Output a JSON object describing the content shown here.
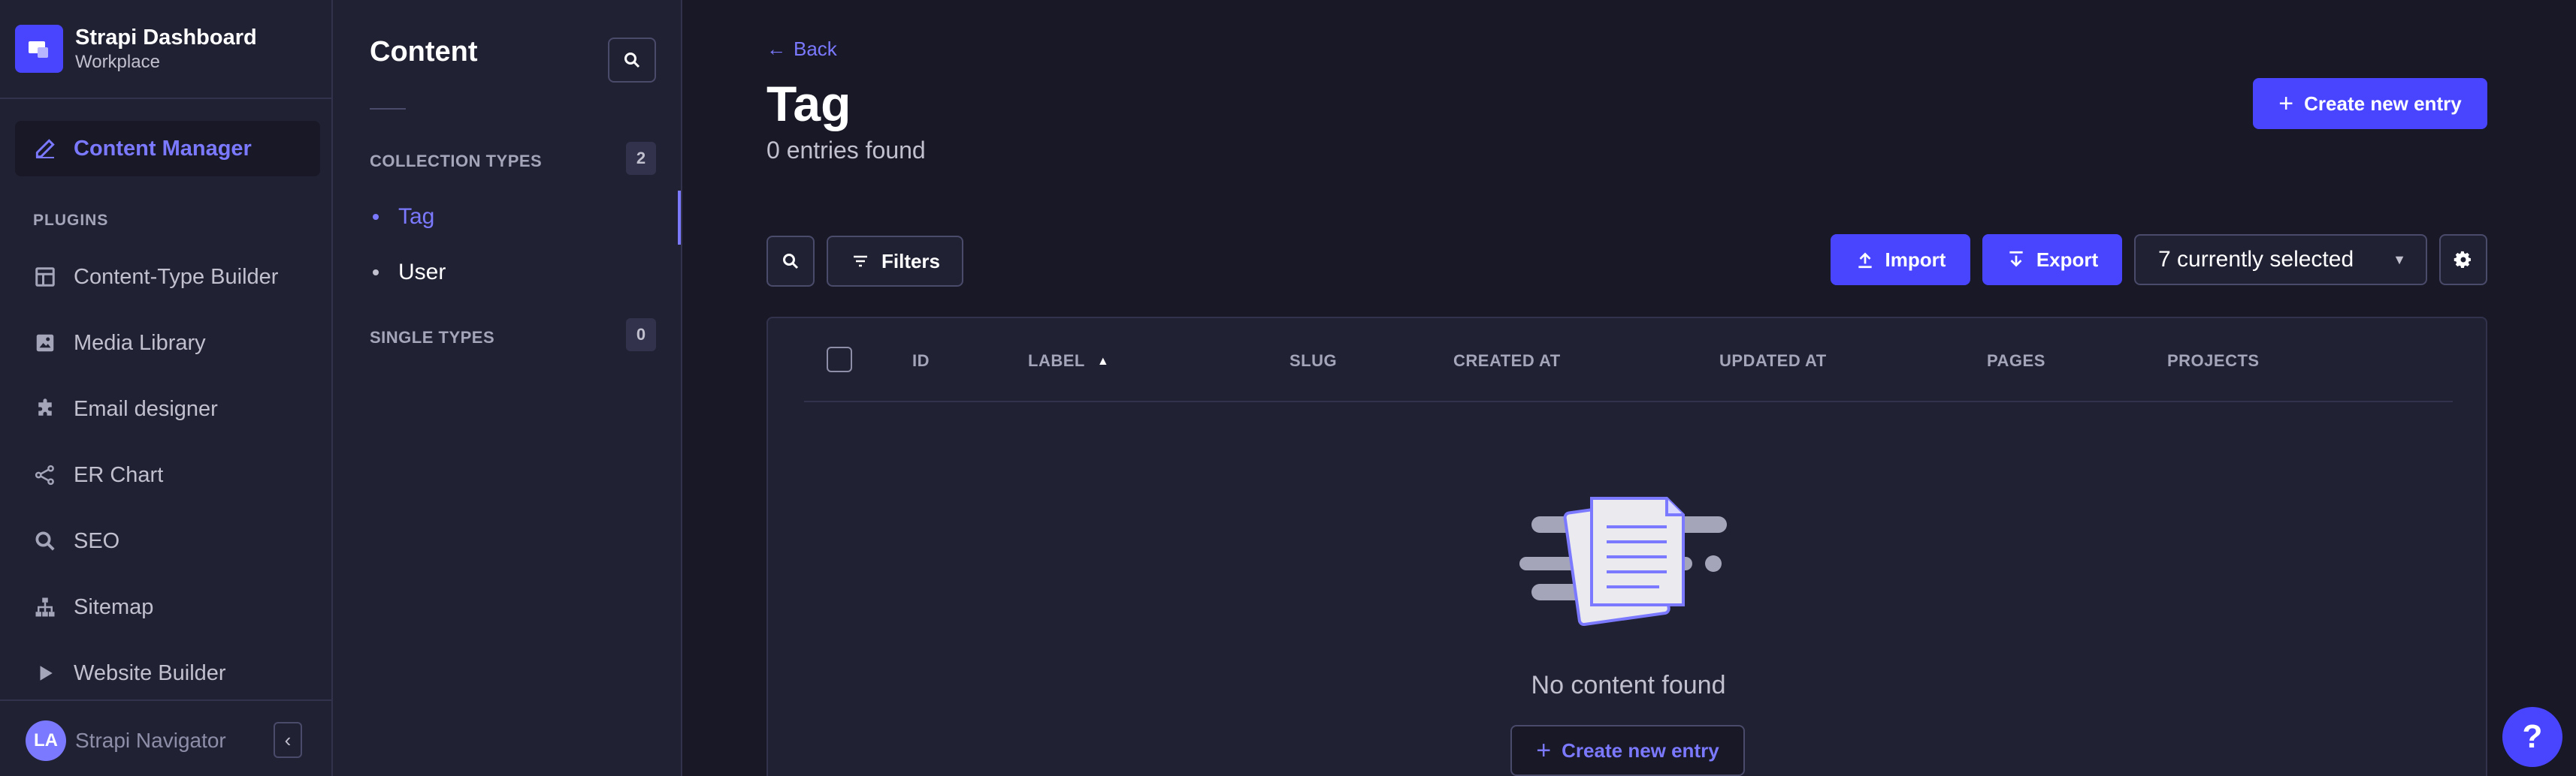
{
  "app": {
    "title": "Strapi Dashboard",
    "workspace": "Workplace"
  },
  "main_nav": {
    "content_manager": "Content Manager",
    "plugins_label": "PLUGINS",
    "plugins": [
      {
        "label": "Content-Type Builder",
        "icon": "layout-icon"
      },
      {
        "label": "Media Library",
        "icon": "image-icon"
      },
      {
        "label": "Email designer",
        "icon": "puzzle-icon"
      },
      {
        "label": "ER Chart",
        "icon": "graph-icon"
      },
      {
        "label": "SEO",
        "icon": "search-icon"
      },
      {
        "label": "Sitemap",
        "icon": "sitemap-icon"
      },
      {
        "label": "Website Builder",
        "icon": "play-icon"
      }
    ],
    "user_initials": "LA",
    "user_name": "Strapi Navigator"
  },
  "sub_nav": {
    "title": "Content",
    "collection_types_label": "COLLECTION TYPES",
    "collection_types_count": "2",
    "collection_types": [
      "Tag",
      "User"
    ],
    "single_types_label": "SINGLE TYPES",
    "single_types_count": "0"
  },
  "main": {
    "back_label": "Back",
    "title": "Tag",
    "entries_found": "0 entries found",
    "create_new_entry": "Create new entry",
    "filters_label": "Filters",
    "import_label": "Import",
    "export_label": "Export",
    "columns_selected": "7 currently selected",
    "columns": [
      "ID",
      "LABEL",
      "SLUG",
      "CREATED AT",
      "UPDATED AT",
      "PAGES",
      "PROJECTS"
    ],
    "empty_text": "No content found",
    "empty_create": "Create new entry"
  },
  "colors": {
    "accent": "#4945ff",
    "accent_text": "#7b79ff",
    "background": "#181826",
    "panel": "#212134"
  }
}
